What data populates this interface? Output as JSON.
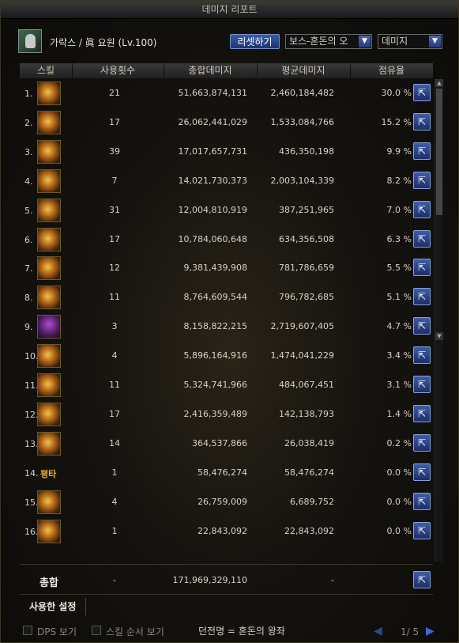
{
  "window": {
    "title": "데미지 리포트"
  },
  "header": {
    "character": "가락스 / 眞 요원 (Lv.100)",
    "reset_label": "리셋하기",
    "boss_select": "보스-혼돈의 오",
    "type_select": "데미지"
  },
  "columns": [
    "스킬",
    "사용횟수",
    "총합데미지",
    "평균데미지",
    "점유율"
  ],
  "rows": [
    {
      "no": "1.",
      "icon": "skill-icon",
      "icon_text": "",
      "count": "21",
      "total": "51,663,874,131",
      "avg": "2,460,184,482",
      "pct": "30.0 %"
    },
    {
      "no": "2.",
      "icon": "skill-icon",
      "icon_text": "",
      "count": "17",
      "total": "26,062,441,029",
      "avg": "1,533,084,766",
      "pct": "15.2 %"
    },
    {
      "no": "3.",
      "icon": "skill-icon",
      "icon_text": "",
      "count": "39",
      "total": "17,017,657,731",
      "avg": "436,350,198",
      "pct": "9.9 %"
    },
    {
      "no": "4.",
      "icon": "skill-icon",
      "icon_text": "",
      "count": "7",
      "total": "14,021,730,373",
      "avg": "2,003,104,339",
      "pct": "8.2 %"
    },
    {
      "no": "5.",
      "icon": "skill-icon",
      "icon_text": "",
      "count": "31",
      "total": "12,004,810,919",
      "avg": "387,251,965",
      "pct": "7.0 %"
    },
    {
      "no": "6.",
      "icon": "skill-icon",
      "icon_text": "",
      "count": "17",
      "total": "10,784,060,648",
      "avg": "634,356,508",
      "pct": "6.3 %"
    },
    {
      "no": "7.",
      "icon": "skill-icon",
      "icon_text": "",
      "count": "12",
      "total": "9,381,439,908",
      "avg": "781,786,659",
      "pct": "5.5 %"
    },
    {
      "no": "8.",
      "icon": "skill-icon",
      "icon_text": "",
      "count": "11",
      "total": "8,764,609,544",
      "avg": "796,782,685",
      "pct": "5.1 %"
    },
    {
      "no": "9.",
      "icon": "purple",
      "icon_text": "",
      "count": "3",
      "total": "8,158,822,215",
      "avg": "2,719,607,405",
      "pct": "4.7 %"
    },
    {
      "no": "10.",
      "icon": "skill-icon",
      "icon_text": "",
      "count": "4",
      "total": "5,896,164,916",
      "avg": "1,474,041,229",
      "pct": "3.4 %"
    },
    {
      "no": "11.",
      "icon": "skill-icon",
      "icon_text": "",
      "count": "11",
      "total": "5,324,741,966",
      "avg": "484,067,451",
      "pct": "3.1 %"
    },
    {
      "no": "12.",
      "icon": "skill-icon",
      "icon_text": "",
      "count": "17",
      "total": "2,416,359,489",
      "avg": "142,138,793",
      "pct": "1.4 %"
    },
    {
      "no": "13.",
      "icon": "skill-icon",
      "icon_text": "",
      "count": "14",
      "total": "364,537,866",
      "avg": "26,038,419",
      "pct": "0.2 %"
    },
    {
      "no": "14.",
      "icon": "text",
      "icon_text": "평타",
      "count": "1",
      "total": "58,476,274",
      "avg": "58,476,274",
      "pct": "0.0 %"
    },
    {
      "no": "15.",
      "icon": "skill-icon",
      "icon_text": "",
      "count": "4",
      "total": "26,759,009",
      "avg": "6,689,752",
      "pct": "0.0 %"
    },
    {
      "no": "16.",
      "icon": "skill-icon",
      "icon_text": "",
      "count": "1",
      "total": "22,843,092",
      "avg": "22,843,092",
      "pct": "0.0 %"
    }
  ],
  "total": {
    "label": "총합",
    "count": "-",
    "total": "171,969,329,110",
    "avg": "-"
  },
  "tabs": {
    "used_settings": "사용한 설정"
  },
  "footer": {
    "dps_label": "DPS 보기",
    "skill_order_label": "스킬 순서 보기",
    "dungeon": "던전명 = 혼돈의 왕좌",
    "page": "1/ 5"
  }
}
